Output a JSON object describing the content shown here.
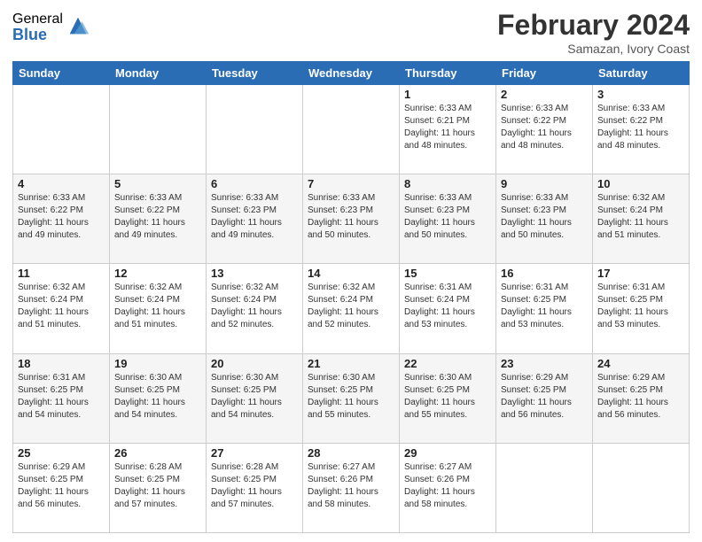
{
  "logo": {
    "general": "General",
    "blue": "Blue"
  },
  "title": "February 2024",
  "subtitle": "Samazan, Ivory Coast",
  "days_of_week": [
    "Sunday",
    "Monday",
    "Tuesday",
    "Wednesday",
    "Thursday",
    "Friday",
    "Saturday"
  ],
  "weeks": [
    [
      {
        "day": "",
        "info": ""
      },
      {
        "day": "",
        "info": ""
      },
      {
        "day": "",
        "info": ""
      },
      {
        "day": "",
        "info": ""
      },
      {
        "day": "1",
        "info": "Sunrise: 6:33 AM\nSunset: 6:21 PM\nDaylight: 11 hours and 48 minutes."
      },
      {
        "day": "2",
        "info": "Sunrise: 6:33 AM\nSunset: 6:22 PM\nDaylight: 11 hours and 48 minutes."
      },
      {
        "day": "3",
        "info": "Sunrise: 6:33 AM\nSunset: 6:22 PM\nDaylight: 11 hours and 48 minutes."
      }
    ],
    [
      {
        "day": "4",
        "info": "Sunrise: 6:33 AM\nSunset: 6:22 PM\nDaylight: 11 hours and 49 minutes."
      },
      {
        "day": "5",
        "info": "Sunrise: 6:33 AM\nSunset: 6:22 PM\nDaylight: 11 hours and 49 minutes."
      },
      {
        "day": "6",
        "info": "Sunrise: 6:33 AM\nSunset: 6:23 PM\nDaylight: 11 hours and 49 minutes."
      },
      {
        "day": "7",
        "info": "Sunrise: 6:33 AM\nSunset: 6:23 PM\nDaylight: 11 hours and 50 minutes."
      },
      {
        "day": "8",
        "info": "Sunrise: 6:33 AM\nSunset: 6:23 PM\nDaylight: 11 hours and 50 minutes."
      },
      {
        "day": "9",
        "info": "Sunrise: 6:33 AM\nSunset: 6:23 PM\nDaylight: 11 hours and 50 minutes."
      },
      {
        "day": "10",
        "info": "Sunrise: 6:32 AM\nSunset: 6:24 PM\nDaylight: 11 hours and 51 minutes."
      }
    ],
    [
      {
        "day": "11",
        "info": "Sunrise: 6:32 AM\nSunset: 6:24 PM\nDaylight: 11 hours and 51 minutes."
      },
      {
        "day": "12",
        "info": "Sunrise: 6:32 AM\nSunset: 6:24 PM\nDaylight: 11 hours and 51 minutes."
      },
      {
        "day": "13",
        "info": "Sunrise: 6:32 AM\nSunset: 6:24 PM\nDaylight: 11 hours and 52 minutes."
      },
      {
        "day": "14",
        "info": "Sunrise: 6:32 AM\nSunset: 6:24 PM\nDaylight: 11 hours and 52 minutes."
      },
      {
        "day": "15",
        "info": "Sunrise: 6:31 AM\nSunset: 6:24 PM\nDaylight: 11 hours and 53 minutes."
      },
      {
        "day": "16",
        "info": "Sunrise: 6:31 AM\nSunset: 6:25 PM\nDaylight: 11 hours and 53 minutes."
      },
      {
        "day": "17",
        "info": "Sunrise: 6:31 AM\nSunset: 6:25 PM\nDaylight: 11 hours and 53 minutes."
      }
    ],
    [
      {
        "day": "18",
        "info": "Sunrise: 6:31 AM\nSunset: 6:25 PM\nDaylight: 11 hours and 54 minutes."
      },
      {
        "day": "19",
        "info": "Sunrise: 6:30 AM\nSunset: 6:25 PM\nDaylight: 11 hours and 54 minutes."
      },
      {
        "day": "20",
        "info": "Sunrise: 6:30 AM\nSunset: 6:25 PM\nDaylight: 11 hours and 54 minutes."
      },
      {
        "day": "21",
        "info": "Sunrise: 6:30 AM\nSunset: 6:25 PM\nDaylight: 11 hours and 55 minutes."
      },
      {
        "day": "22",
        "info": "Sunrise: 6:30 AM\nSunset: 6:25 PM\nDaylight: 11 hours and 55 minutes."
      },
      {
        "day": "23",
        "info": "Sunrise: 6:29 AM\nSunset: 6:25 PM\nDaylight: 11 hours and 56 minutes."
      },
      {
        "day": "24",
        "info": "Sunrise: 6:29 AM\nSunset: 6:25 PM\nDaylight: 11 hours and 56 minutes."
      }
    ],
    [
      {
        "day": "25",
        "info": "Sunrise: 6:29 AM\nSunset: 6:25 PM\nDaylight: 11 hours and 56 minutes."
      },
      {
        "day": "26",
        "info": "Sunrise: 6:28 AM\nSunset: 6:25 PM\nDaylight: 11 hours and 57 minutes."
      },
      {
        "day": "27",
        "info": "Sunrise: 6:28 AM\nSunset: 6:25 PM\nDaylight: 11 hours and 57 minutes."
      },
      {
        "day": "28",
        "info": "Sunrise: 6:27 AM\nSunset: 6:26 PM\nDaylight: 11 hours and 58 minutes."
      },
      {
        "day": "29",
        "info": "Sunrise: 6:27 AM\nSunset: 6:26 PM\nDaylight: 11 hours and 58 minutes."
      },
      {
        "day": "",
        "info": ""
      },
      {
        "day": "",
        "info": ""
      }
    ]
  ]
}
